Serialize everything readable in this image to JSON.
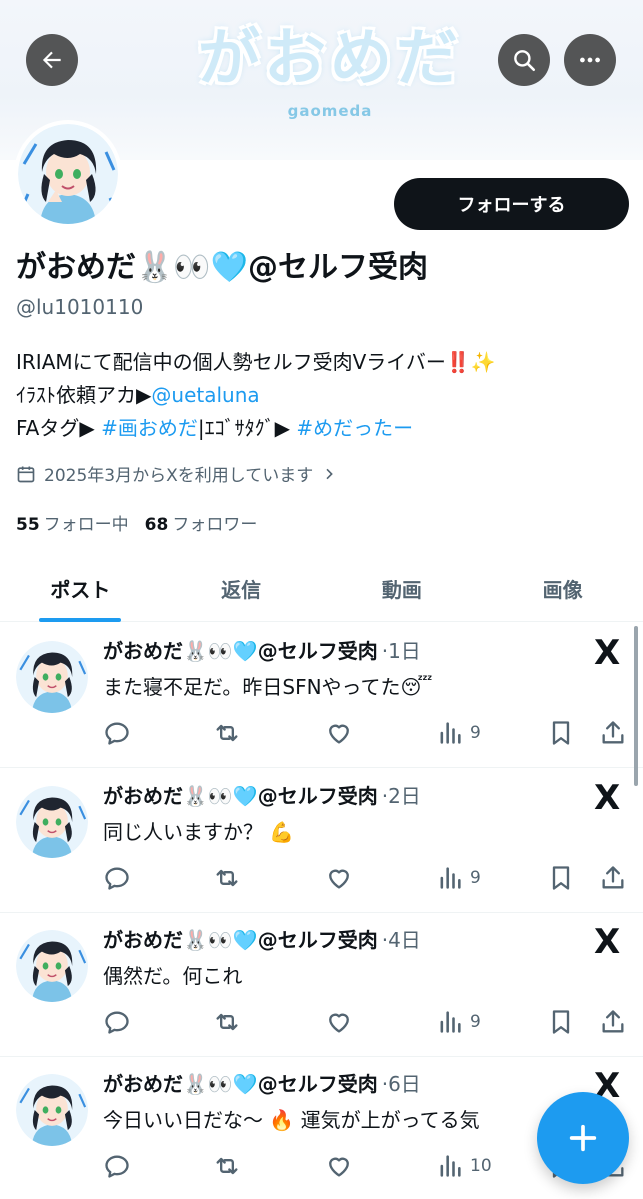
{
  "banner": {
    "logo_text": "がおめだ",
    "logo_sub": "gaomeda"
  },
  "profile": {
    "follow_label": "フォローする",
    "name": "がおめだ🐰👀🩵@セルフ受肉",
    "handle": "@lu1010110",
    "bio": {
      "line1": "IRIAMにて配信中の個人勢セルフ受肉Vライバー‼️✨",
      "line2_prefix": "ｲﾗｽﾄ依頼アカ▶",
      "line2_link": "@uetaluna",
      "line3_prefix": "FAタグ▶ ",
      "line3_tag1": "#画おめだ",
      "line3_mid": "|ｴｺﾞｻﾀｸﾞ▶ ",
      "line3_tag2": "#めだったー"
    },
    "joined": "2025年3月からXを利用しています",
    "following_count": "55",
    "following_label": "フォロー中",
    "followers_count": "68",
    "followers_label": "フォロワー"
  },
  "tabs": [
    "ポスト",
    "返信",
    "動画",
    "画像"
  ],
  "posts": [
    {
      "name": "がおめだ🐰👀🩵@セルフ受肉",
      "time": "·1日",
      "text": "また寝不足だ。昨日SFNやってた😴",
      "views": "9"
    },
    {
      "name": "がおめだ🐰👀🩵@セルフ受肉",
      "time": "·2日",
      "text": "同じ人いますか？ 💪",
      "views": "9"
    },
    {
      "name": "がおめだ🐰👀🩵@セルフ受肉",
      "time": "·4日",
      "text": "偶然だ。何これ",
      "views": "9"
    },
    {
      "name": "がおめだ🐰👀🩵@セルフ受肉",
      "time": "·6日",
      "text": "今日いい日だな～ 🔥 運気が上がってる気",
      "views": "10"
    }
  ],
  "x_logo": "X",
  "colors": {
    "accent": "#1d9bf0",
    "text": "#0f1419",
    "muted": "#536471"
  }
}
